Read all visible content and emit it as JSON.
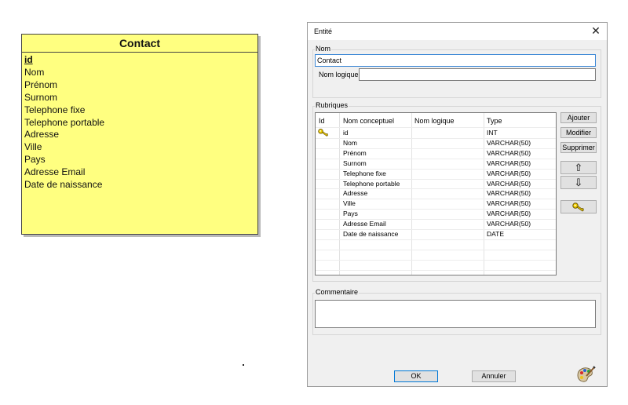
{
  "canvas": {
    "entity": {
      "title": "Contact",
      "fields": [
        "id",
        "Nom",
        "Prénom",
        "Surnom",
        "Telephone fixe",
        "Telephone portable",
        "Adresse",
        "Ville",
        "Pays",
        "Adresse Email",
        "Date de naissance"
      ]
    }
  },
  "dialog": {
    "title": "Entité",
    "close": "✕",
    "nom_group": "Nom",
    "nom_value": "Contact",
    "nom_logique_label": "Nom logique :",
    "nom_logique_value": "",
    "rubriques_group": "Rubriques",
    "columns": [
      "Id",
      "Nom conceptuel",
      "Nom logique",
      "Type"
    ],
    "rows": [
      {
        "pk": true,
        "name": "id",
        "logical": "",
        "type": "INT"
      },
      {
        "pk": false,
        "name": "Nom",
        "logical": "",
        "type": "VARCHAR(50)"
      },
      {
        "pk": false,
        "name": "Prénom",
        "logical": "",
        "type": "VARCHAR(50)"
      },
      {
        "pk": false,
        "name": "Surnom",
        "logical": "",
        "type": "VARCHAR(50)"
      },
      {
        "pk": false,
        "name": "Telephone fixe",
        "logical": "",
        "type": "VARCHAR(50)"
      },
      {
        "pk": false,
        "name": "Telephone portable",
        "logical": "",
        "type": "VARCHAR(50)"
      },
      {
        "pk": false,
        "name": "Adresse",
        "logical": "",
        "type": "VARCHAR(50)"
      },
      {
        "pk": false,
        "name": "Ville",
        "logical": "",
        "type": "VARCHAR(50)"
      },
      {
        "pk": false,
        "name": "Pays",
        "logical": "",
        "type": "VARCHAR(50)"
      },
      {
        "pk": false,
        "name": "Adresse Email",
        "logical": "",
        "type": "VARCHAR(50)"
      },
      {
        "pk": false,
        "name": "Date de naissance",
        "logical": "",
        "type": "DATE"
      }
    ],
    "buttons": {
      "ajouter": "Ajouter",
      "modifier": "Modifier",
      "supprimer": "Supprimer",
      "up": "⇧",
      "down": "⇩"
    },
    "commentaire_group": "Commentaire",
    "commentaire_value": "",
    "ok": "OK",
    "annuler": "Annuler"
  }
}
